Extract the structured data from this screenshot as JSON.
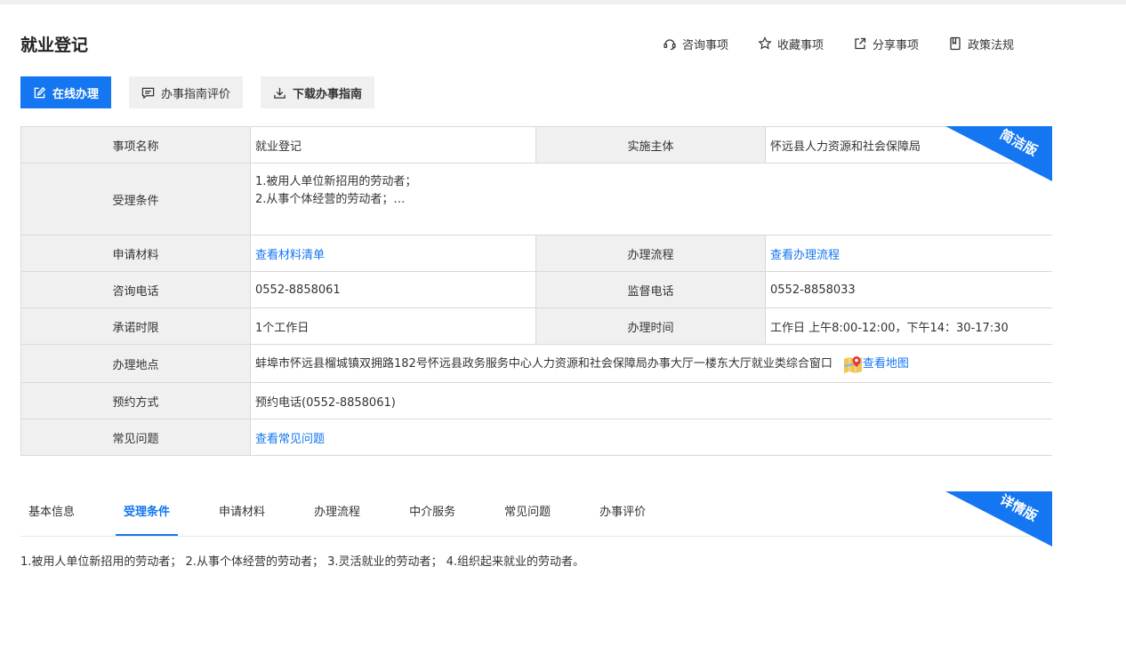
{
  "page_title": "就业登记",
  "actions": [
    {
      "label": "咨询事项",
      "icon": "consult-icon"
    },
    {
      "label": "收藏事项",
      "icon": "star-icon"
    },
    {
      "label": "分享事项",
      "icon": "share-icon"
    },
    {
      "label": "政策法规",
      "icon": "document-icon"
    }
  ],
  "buttons": {
    "online": "在线办理",
    "evaluate": "办事指南评价",
    "download": "下载办事指南"
  },
  "summary": {
    "ribbon": "简洁版",
    "item_name_label": "事项名称",
    "item_name": "就业登记",
    "subject_label": "实施主体",
    "subject": "怀远县人力资源和社会保障局",
    "conditions_label": "受理条件",
    "conditions_line1": "1.被用人单位新招用的劳动者；",
    "conditions_line2": "2.从事个体经营的劳动者；…",
    "materials_label": "申请材料",
    "materials_link": "查看材料清单",
    "process_label": "办理流程",
    "process_link": "查看办理流程",
    "consult_phone_label": "咨询电话",
    "consult_phone": "0552-8858061",
    "supervise_phone_label": "监督电话",
    "supervise_phone": "0552-8858033",
    "time_limit_label": "承诺时限",
    "time_limit": "1个工作日",
    "office_hours_label": "办理时间",
    "office_hours": "工作日 上午8:00-12:00，下午14：30-17:30",
    "address_label": "办理地点",
    "address": "蚌埠市怀远县榴城镇双拥路182号怀远县政务服务中心人力资源和社会保障局办事大厅一楼东大厅就业类综合窗口",
    "map_link": "查看地图",
    "appointment_label": "预约方式",
    "appointment": "预约电话(0552-8858061)",
    "faq_label": "常见问题",
    "faq_link": "查看常见问题"
  },
  "tabs": [
    {
      "label": "基本信息",
      "active": false
    },
    {
      "label": "受理条件",
      "active": true
    },
    {
      "label": "申请材料",
      "active": false
    },
    {
      "label": "办理流程",
      "active": false
    },
    {
      "label": "中介服务",
      "active": false
    },
    {
      "label": "常见问题",
      "active": false
    },
    {
      "label": "办事评价",
      "active": false
    }
  ],
  "detail_ribbon": "详情版",
  "detail_text": "1.被用人单位新招用的劳动者； 2.从事个体经营的劳动者； 3.灵活就业的劳动者； 4.组织起来就业的劳动者。",
  "colors": {
    "accent": "#1476f0",
    "label_bg": "#f0f0f0",
    "border": "#d9d9d9"
  }
}
